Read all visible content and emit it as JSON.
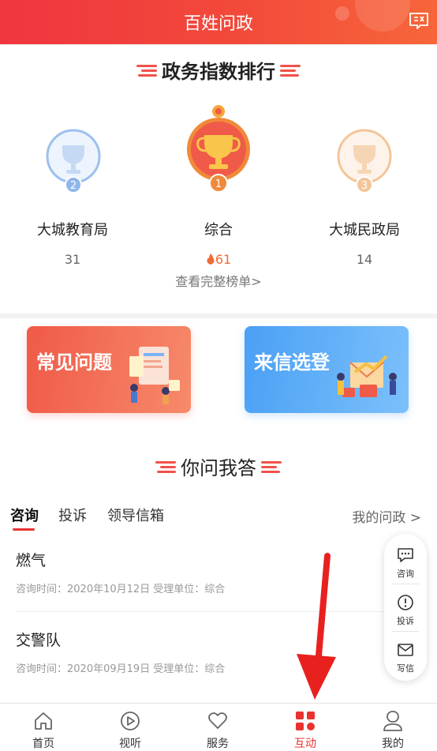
{
  "header": {
    "title": "百姓问政",
    "msg_icon": "message-list-icon"
  },
  "ranking": {
    "title": "政务指数排行",
    "items": [
      {
        "rank": "2",
        "name": "大城教育局",
        "score": "31",
        "color": "#8fb7ec"
      },
      {
        "rank": "1",
        "name": "综合",
        "score": "61",
        "color": "#f05a48",
        "hot": true
      },
      {
        "rank": "3",
        "name": "大城民政局",
        "score": "14",
        "color": "#f3c59a"
      }
    ],
    "view_all": "查看完整榜单>"
  },
  "features": [
    {
      "label": "常见问题",
      "color": "#f05a48"
    },
    {
      "label": "来信选登",
      "color": "#4aa0f5"
    }
  ],
  "qa": {
    "title": "你问我答",
    "tabs": [
      "咨询",
      "投诉",
      "领导信箱"
    ],
    "my_link": "我的问政 >",
    "items": [
      {
        "title": "燃气",
        "meta": "咨询时间：2020年10月12日    受理单位：综合"
      },
      {
        "title": "交警队",
        "meta": "咨询时间：2020年09月19日    受理单位：综合"
      }
    ]
  },
  "float_bar": {
    "items": [
      {
        "label": "咨询",
        "icon": "chat-icon"
      },
      {
        "label": "投诉",
        "icon": "alert-icon"
      },
      {
        "label": "写信",
        "icon": "mail-icon"
      }
    ]
  },
  "bottom_nav": {
    "items": [
      {
        "label": "首页",
        "icon": "home-icon"
      },
      {
        "label": "视听",
        "icon": "play-icon"
      },
      {
        "label": "服务",
        "icon": "heart-icon"
      },
      {
        "label": "互动",
        "icon": "grid-icon",
        "active": true
      },
      {
        "label": "我的",
        "icon": "user-icon"
      }
    ]
  },
  "colors": {
    "brand": "#e8332f",
    "accent_orange": "#f06a35",
    "blue": "#4aa0f5"
  }
}
